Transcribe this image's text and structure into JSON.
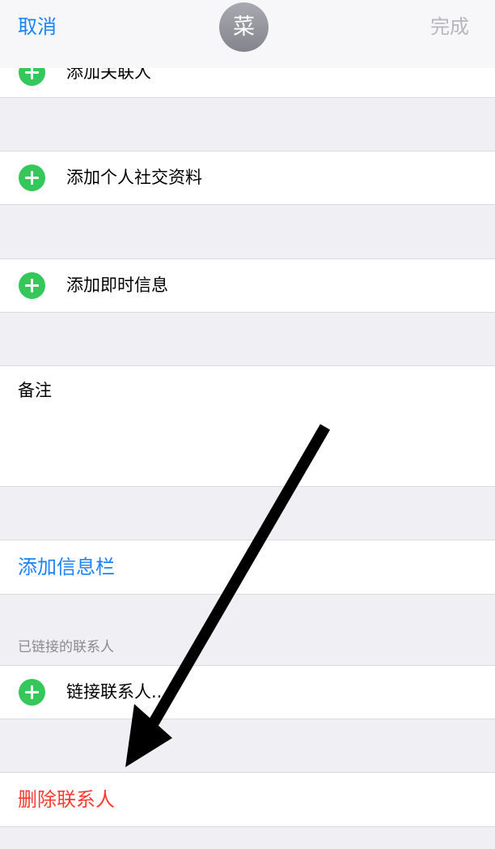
{
  "nav": {
    "cancel_label": "取消",
    "avatar_text": "菜",
    "done_label": "完成"
  },
  "rows": {
    "add_related": "添加关联人",
    "add_social_profile": "添加个人社交资料",
    "add_instant_message": "添加即时信息",
    "notes_label": "备注",
    "add_field": "添加信息栏",
    "linked_contacts_header": "已链接的联系人",
    "link_contact": "链接联系人...",
    "delete_contact": "删除联系人"
  },
  "colors": {
    "accent_blue": "#1a82fb",
    "destructive_red": "#ff3b30",
    "add_green": "#35c759",
    "disabled_gray": "#b6b6bb"
  }
}
